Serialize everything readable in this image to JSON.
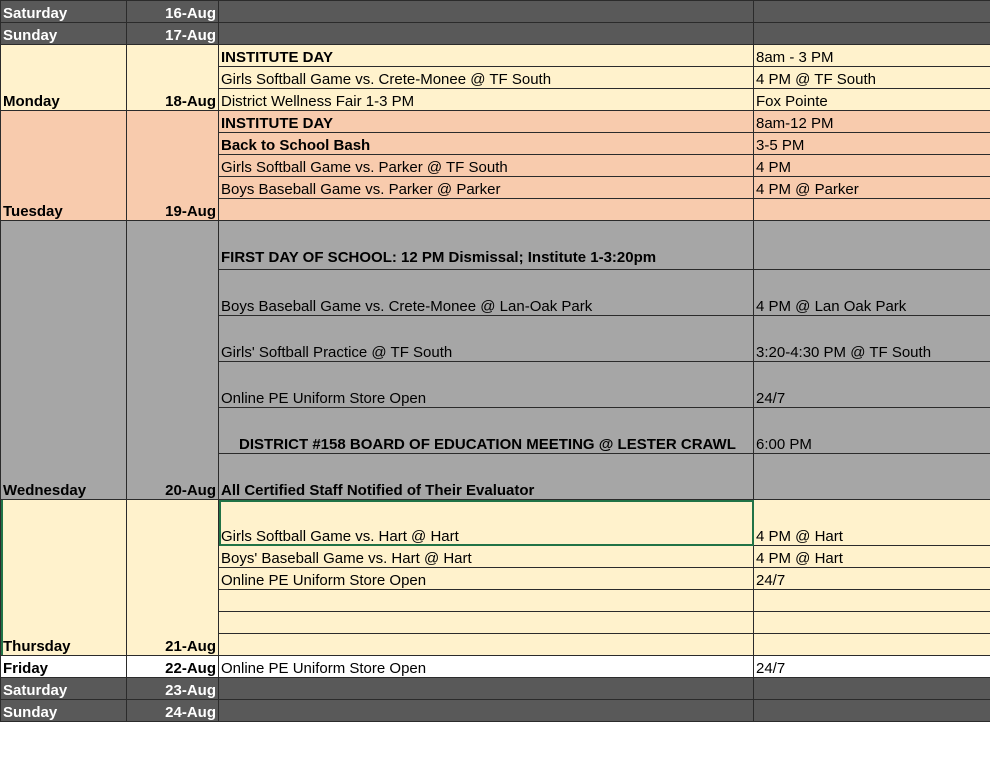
{
  "days": {
    "sat1": {
      "day": "Saturday",
      "date": "16-Aug"
    },
    "sun1": {
      "day": "Sunday",
      "date": "17-Aug"
    },
    "mon": {
      "day": "Monday",
      "date": "18-Aug"
    },
    "tue": {
      "day": "Tuesday",
      "date": "19-Aug"
    },
    "wed": {
      "day": "Wednesday",
      "date": "20-Aug"
    },
    "thu": {
      "day": "Thursday",
      "date": "21-Aug"
    },
    "fri": {
      "day": "Friday",
      "date": "22-Aug"
    },
    "sat2": {
      "day": "Saturday",
      "date": "23-Aug"
    },
    "sun2": {
      "day": "Sunday",
      "date": "24-Aug"
    }
  },
  "events": {
    "mon": [
      {
        "event": "INSTITUTE DAY",
        "time": "8am - 3 PM"
      },
      {
        "event": "Girls Softball Game vs. Crete-Monee @ TF South",
        "time": "4 PM @ TF South"
      },
      {
        "event": "District Wellness Fair 1-3 PM",
        "time": "Fox Pointe"
      }
    ],
    "tue": [
      {
        "event": "INSTITUTE DAY",
        "time": "8am-12 PM"
      },
      {
        "event": "Back to School Bash",
        "time": "3-5 PM"
      },
      {
        "event": "Girls Softball Game vs. Parker @ TF South",
        "time": "4 PM"
      },
      {
        "event": "Boys Baseball Game vs. Parker @ Parker",
        "time": "4 PM @ Parker"
      },
      {
        "event": "",
        "time": ""
      }
    ],
    "wed": [
      {
        "event": "FIRST DAY OF SCHOOL: 12 PM Dismissal; Institute 1-3:20pm",
        "time": ""
      },
      {
        "event": "Boys Baseball Game vs. Crete-Monee @ Lan-Oak Park",
        "time": "4 PM @ Lan Oak Park"
      },
      {
        "event": "Girls' Softball Practice @ TF South",
        "time": "3:20-4:30 PM @ TF South"
      },
      {
        "event": "Online PE Uniform Store Open",
        "time": "24/7"
      },
      {
        "event": "DISTRICT #158 BOARD OF EDUCATION MEETING @ LESTER CRAWL",
        "time": "6:00 PM"
      },
      {
        "event": "All Certified Staff Notified of Their Evaluator",
        "time": ""
      }
    ],
    "thu": [
      {
        "event": "Girls Softball Game vs. Hart @ Hart",
        "time": "4 PM @ Hart"
      },
      {
        "event": "Boys' Baseball Game vs. Hart @ Hart",
        "time": "4 PM @ Hart"
      },
      {
        "event": "Online PE Uniform Store Open",
        "time": "24/7"
      },
      {
        "event": "",
        "time": ""
      },
      {
        "event": "",
        "time": ""
      },
      {
        "event": "",
        "time": ""
      }
    ],
    "fri": [
      {
        "event": "Online PE Uniform Store Open",
        "time": "24/7"
      }
    ]
  }
}
